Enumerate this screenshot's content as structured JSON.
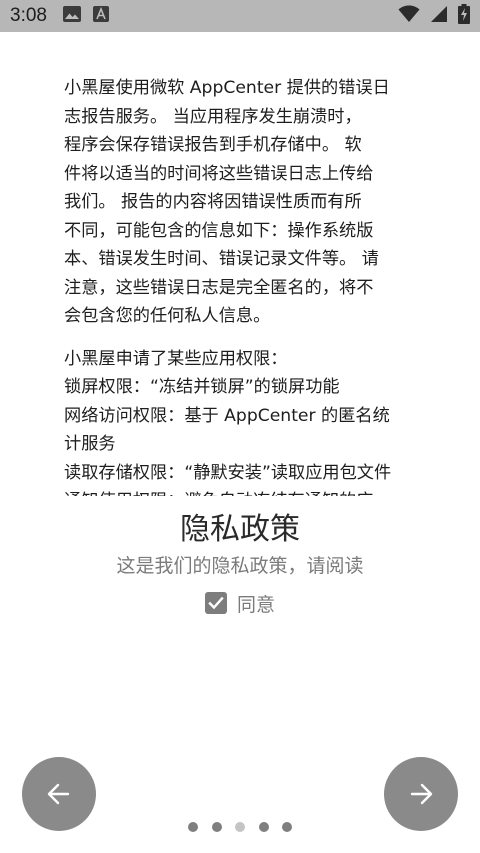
{
  "status_bar": {
    "time": "3:08",
    "left_icons": [
      "image-icon",
      "text-icon"
    ],
    "right_icons": [
      "wifi-icon",
      "signal-icon",
      "battery-charging-icon"
    ]
  },
  "content": {
    "paragraph1": "小黑屋使用微软 AppCenter 提供的错误日志报告服务。 当应用程序发生崩溃时，程序会保存错误报告到手机存储中。 软件将以适当的时间将这些错误日志上传给我们。 报告的内容将因错误性质而有所不同，可能包含的信息如下：操作系统版本、错误发生时间、错误记录文件等。 请注意，这些错误日志是完全匿名的，将不会包含您的任何私人信息。",
    "lines1": [
      "小黑屋使用微软 AppCenter 提供的错误日",
      "志报告服务。 当应用程序发生崩溃时，",
      "程序会保存错误报告到手机存储中。 软",
      "件将以适当的时间将这些错误日志上传给",
      "我们。 报告的内容将因错误性质而有所",
      "不同，可能包含的信息如下：操作系统版",
      "本、错误发生时间、错误记录文件等。 请",
      "注意，这些错误日志是完全匿名的，将不",
      "会包含您的任何私人信息。"
    ],
    "lines2": [
      "小黑屋申请了某些应用权限：",
      "锁屏权限：“冻结并锁屏”的锁屏功能",
      "网络访问权限：基于 AppCenter 的匿名统",
      "计服务",
      "读取存储权限：“静默安装”读取应用包文件",
      "通知使用权限：避免自动冻结有通知的应"
    ]
  },
  "page": {
    "title": "隐私政策",
    "subtitle": "这是我们的隐私政策，请阅读",
    "agree_label": "同意",
    "agree_checked": true
  },
  "navigation": {
    "prev_icon": "arrow-left-icon",
    "next_icon": "arrow-right-icon",
    "page_count": 5,
    "current_page": 3
  },
  "colors": {
    "status_bar": "#b7b7b7",
    "nav_button": "#8a8a8a",
    "dot": "#7f7f7f",
    "dot_active": "#c4c4c4",
    "subtitle": "#7b7b7b"
  }
}
